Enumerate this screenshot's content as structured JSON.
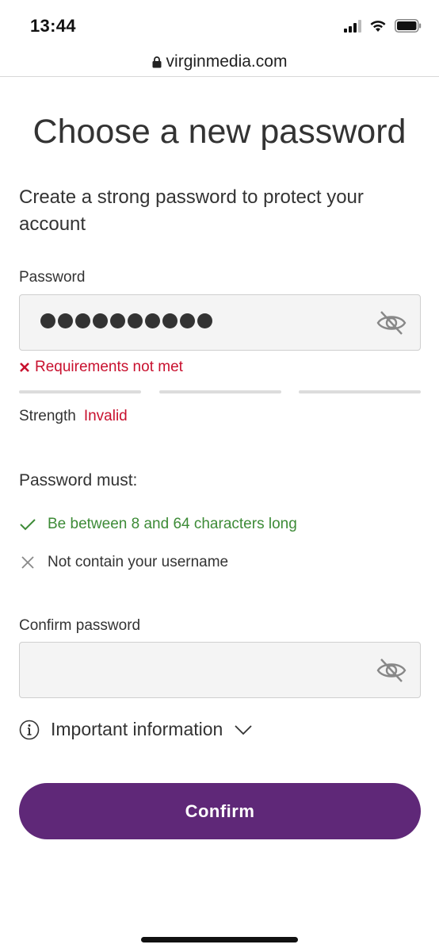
{
  "status_bar": {
    "time": "13:44",
    "icons": [
      "signal-icon",
      "wifi-icon",
      "battery-icon"
    ]
  },
  "browser": {
    "url": "virginmedia.com",
    "lock_icon": "lock-icon"
  },
  "page": {
    "title": "Choose a new password",
    "subtitle": "Create a strong password to protect your account"
  },
  "password_field": {
    "label": "Password",
    "masked_length": 10,
    "toggle_icon": "eye-off-icon"
  },
  "validation": {
    "error_text": "Requirements not met",
    "strength_label": "Strength",
    "strength_value": "Invalid",
    "strength_segments": 3,
    "strength_filled": 0
  },
  "rules": {
    "heading": "Password must:",
    "items": [
      {
        "text": "Be between 8 and 64 characters long",
        "status": "pass"
      },
      {
        "text": "Not contain your username",
        "status": "fail"
      }
    ]
  },
  "confirm_field": {
    "label": "Confirm password",
    "value": "",
    "toggle_icon": "eye-off-icon"
  },
  "info": {
    "label": "Important information"
  },
  "actions": {
    "confirm_label": "Confirm"
  },
  "colors": {
    "brand_purple": "#5f2878",
    "error_red": "#c8102e",
    "success_green": "#3d8b37",
    "input_bg": "#f4f4f4"
  }
}
